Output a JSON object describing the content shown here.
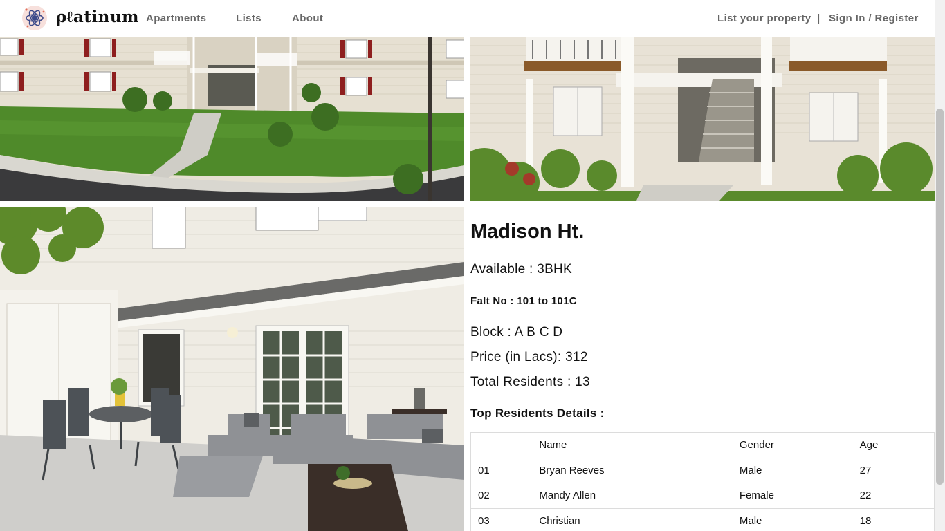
{
  "brand": {
    "name": "ρℓatinum",
    "logo_icon": "atom-icon"
  },
  "nav": {
    "apartments": "Apartments",
    "lists": "Lists",
    "about": "About",
    "list_property": "List your property",
    "separator": "|",
    "sign_in": "Sign In / Register"
  },
  "property": {
    "name": "Madison Ht.",
    "available": "Available : 3BHK",
    "flat_no": "Falt No : 101 to 101C",
    "block": "Block : A B C D",
    "price": "Price (in Lacs): 312",
    "total_residents": "Total Residents : 13",
    "top_residents_heading": "Top Residents Details :"
  },
  "residents_table": {
    "headers": [
      "",
      "Name",
      "Gender",
      "Age"
    ],
    "rows": [
      [
        "01",
        "Bryan Reeves",
        "Male",
        "27"
      ],
      [
        "02",
        "Mandy Allen",
        "Female",
        "22"
      ],
      [
        "03",
        "Christian",
        "Male",
        "18"
      ]
    ]
  },
  "colors": {
    "nav_text": "#666666",
    "logo_badge": "#f7e0dc",
    "lawn": "#4f8a2a",
    "siding": "#e8e2d6"
  }
}
